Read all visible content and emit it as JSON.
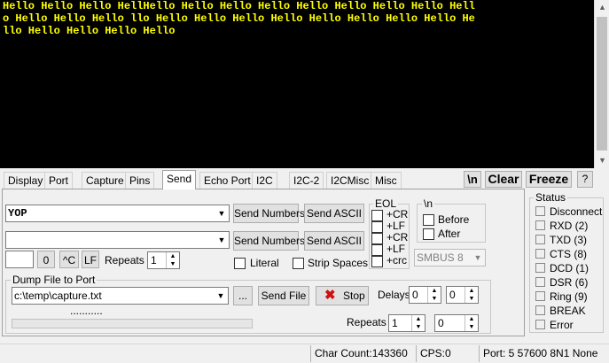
{
  "terminal": {
    "lines": [
      "Hello Hello Hello HellHello Hello Hello Hello Hello Hello Hello Hello Hell",
      "o Hello Hello Hello llo Hello Hello Hello Hello Hello Hello Hello Hello He",
      "llo Hello Hello Hello Hello"
    ]
  },
  "tabs": [
    "Display",
    "Port",
    "Capture",
    "Pins",
    "Send",
    "Echo Port",
    "I2C",
    "I2C-2",
    "I2CMisc",
    "Misc"
  ],
  "toolbar": {
    "newline": "\\n",
    "clear": "Clear",
    "freeze": "Freeze",
    "help": "?"
  },
  "send": {
    "row1_value": "YOP",
    "row2_value": "",
    "send_numbers": "Send Numbers",
    "send_ascii": "Send ASCII",
    "num_value": "",
    "zero": "0",
    "ctrl_c": "^C",
    "lf": "LF",
    "repeats_label": "Repeats",
    "repeats_value": "1",
    "literal": "Literal",
    "strip_spaces": "Strip Spaces"
  },
  "eol": {
    "legend": "EOL",
    "cr1": "+CR",
    "lf1": "+LF",
    "cr2": "+CR",
    "lf2": "+LF",
    "crc": "+crc"
  },
  "newline_group": {
    "legend": "\\n",
    "before": "Before",
    "after": "After"
  },
  "smbus": "SMBUS 8",
  "dump": {
    "legend": "Dump File to Port",
    "path": "c:\\temp\\capture.txt",
    "browse": "...",
    "progress_text": "...........",
    "send_file": "Send File",
    "stop": "Stop",
    "delays_label": "Delays",
    "delay1": "0",
    "delay2": "0",
    "repeats_label": "Repeats",
    "repeats1": "1",
    "repeats2": "0"
  },
  "status_panel": {
    "legend": "Status",
    "items": [
      "Disconnect",
      "RXD (2)",
      "TXD (3)",
      "CTS (8)",
      "DCD (1)",
      "DSR (6)",
      "Ring (9)",
      "BREAK",
      "Error"
    ]
  },
  "statusbar": {
    "char_count": "Char Count:143360",
    "cps": "CPS:0",
    "port": "Port: 5  57600 8N1 None"
  }
}
